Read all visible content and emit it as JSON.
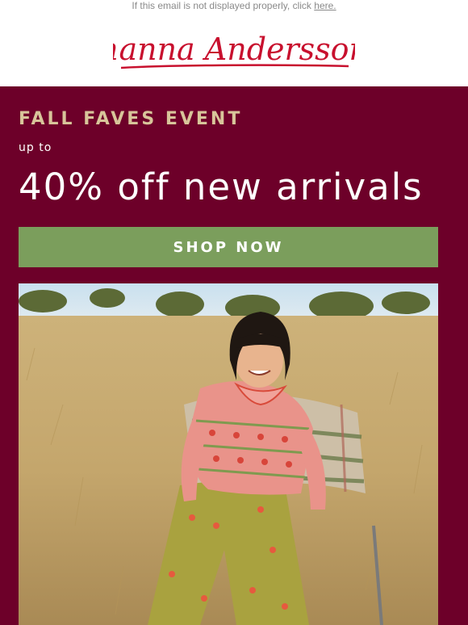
{
  "preheader": {
    "text": "If this email is not displayed properly, click",
    "link_text": "here."
  },
  "brand": {
    "logo_text": "hanna Andersson",
    "color": "#c8102e"
  },
  "hero": {
    "eyebrow": "FALL FAVES EVENT",
    "upto": "up to",
    "headline": "40% off new arrivals",
    "cta_label": "SHOP NOW",
    "colors": {
      "background": "#6d0029",
      "eyebrow": "#d8c59a",
      "cta": "#7b9e5c"
    }
  },
  "photo": {
    "subject": "child-on-chair-in-field-photo"
  }
}
